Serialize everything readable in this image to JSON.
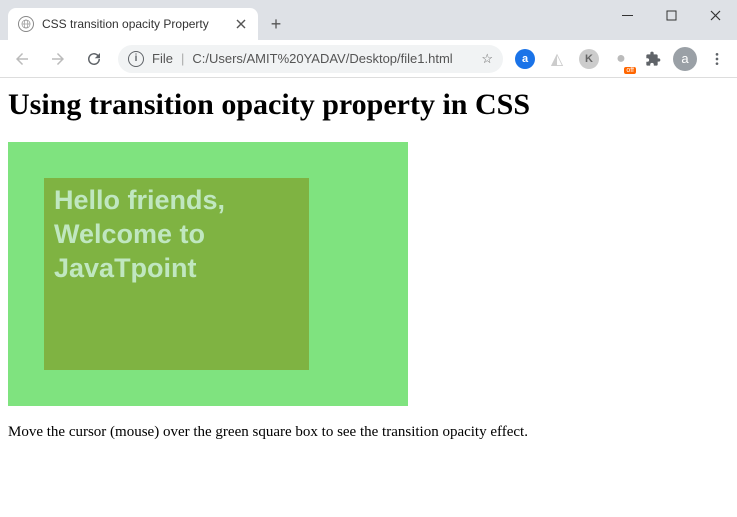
{
  "window": {
    "tab_title": "CSS transition opacity Property",
    "new_tab_label": "+"
  },
  "toolbar": {
    "url_prefix": "File",
    "url_separator": "|",
    "url_path": "C:/Users/AMIT%20YADAV/Desktop/file1.html",
    "avatar_initial": "a",
    "off_badge": "off"
  },
  "page": {
    "heading": "Using transition opacity property in CSS",
    "box_line1": "Hello friends,",
    "box_line2": "Welcome to",
    "box_line3": "JavaTpoint",
    "note": "Move the cursor (mouse) over the green square box to see the transition opacity effect."
  }
}
